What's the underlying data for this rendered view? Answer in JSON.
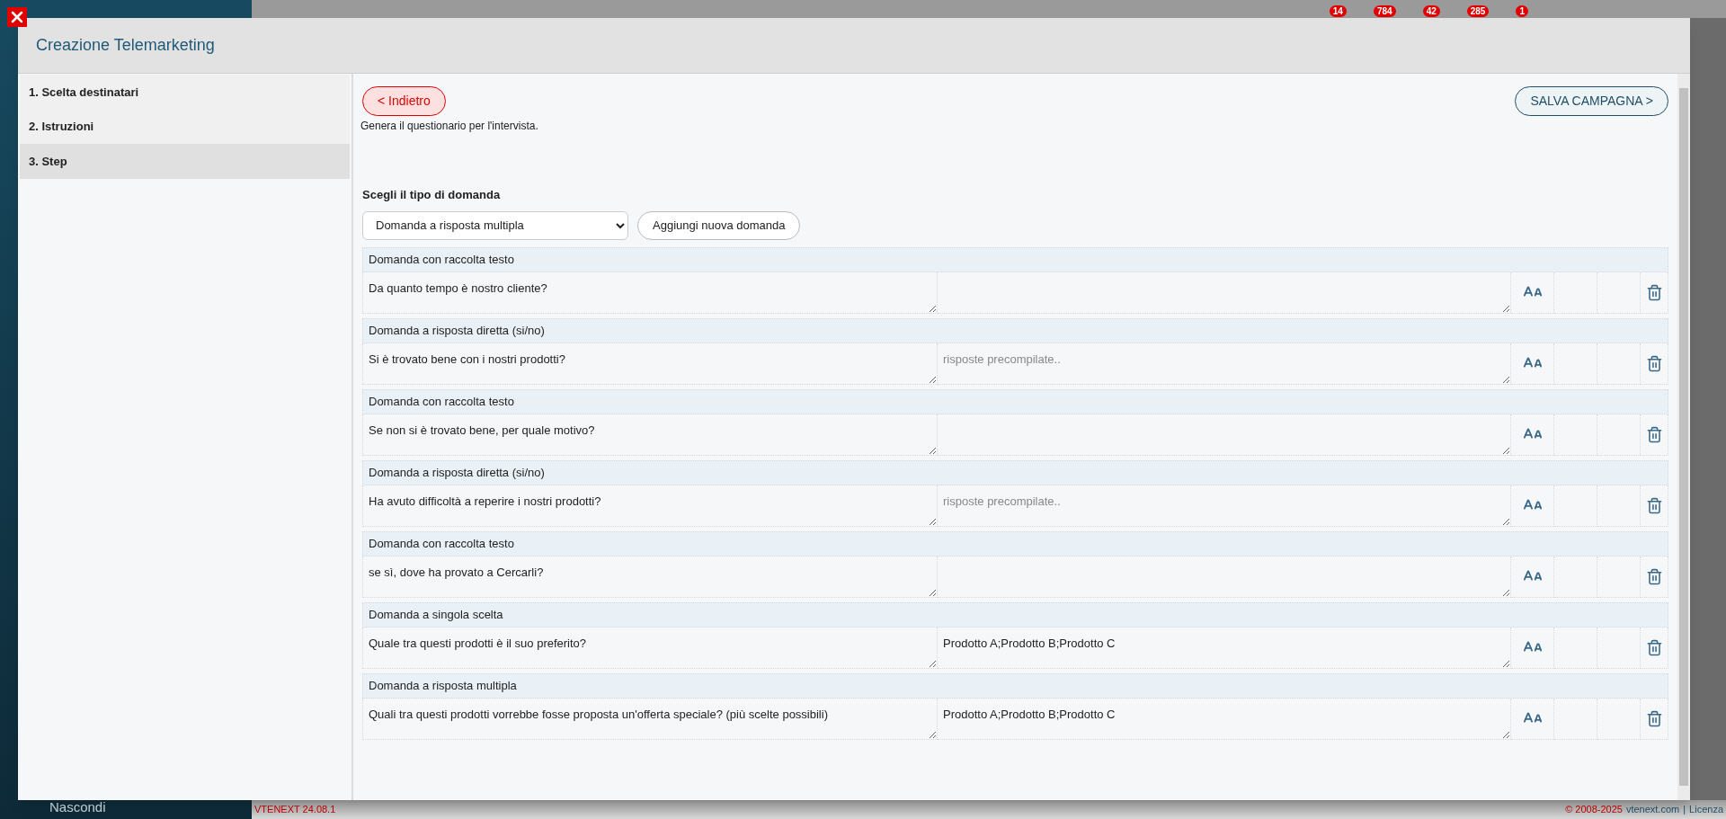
{
  "top_bar": {
    "badges": [
      "14",
      "784",
      "42",
      "285",
      "1"
    ]
  },
  "side_nav": {
    "hide_label": "Nascondi"
  },
  "dialog": {
    "title": "Creazione Telemarketing",
    "steps": [
      {
        "label": "1. Scelta destinatari",
        "selected": false
      },
      {
        "label": "2. Istruzioni",
        "selected": false
      },
      {
        "label": "3. Step",
        "selected": true
      }
    ],
    "back_button": "< Indietro",
    "save_button": "SALVA CAMPAGNA >",
    "description": "Genera il questionario per l'intervista.",
    "question_type_label": "Scegli il tipo di domanda",
    "question_type_select": "Domanda a risposta multipla",
    "add_button": "Aggiungi nuova domanda",
    "questions": [
      {
        "type": "Domanda con raccolta testo",
        "text": "Da quanto tempo è nostro cliente?"
      },
      {
        "type": "Domanda a risposta diretta (si/no)",
        "text": "Si è trovato bene con i nostri prodotti?",
        "answers_placeholder": "risposte precompilate.."
      },
      {
        "type": "Domanda con raccolta testo",
        "text": "Se non si è trovato bene, per quale motivo?"
      },
      {
        "type": "Domanda a risposta diretta (si/no)",
        "text": "Ha avuto difficoltà a reperire i nostri prodotti?",
        "answers_placeholder": "risposte precompilate.."
      },
      {
        "type": "Domanda con raccolta testo",
        "text": "se sì, dove ha provato a Cercarli?"
      },
      {
        "type": "Domanda a singola scelta",
        "text": "Quale tra questi prodotti è il suo preferito?",
        "answers": "Prodotto A;Prodotto B;Prodotto C"
      },
      {
        "type": "Domanda a risposta multipla",
        "text": "Quali tra questi prodotti vorrebbe fosse proposta un'offerta speciale? (più scelte possibili)",
        "answers": "Prodotto A;Prodotto B;Prodotto C"
      }
    ]
  },
  "footer": {
    "version": "VTENEXT 24.08.1",
    "copyright": "© 2008-2025",
    "site_link": "vtenext.com",
    "separator": "|",
    "license_link": "Licenza"
  }
}
